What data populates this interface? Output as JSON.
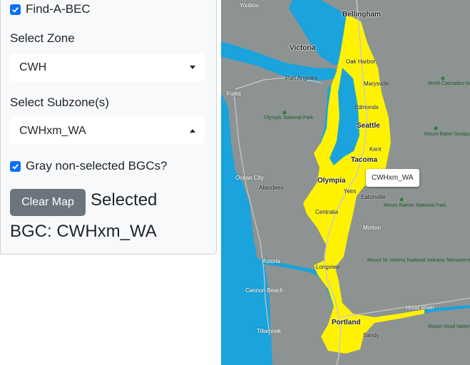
{
  "app": {
    "title": "Find-A-BEC"
  },
  "controls": {
    "zone_label": "Select Zone",
    "zone_value": "CWH",
    "subzone_label": "Select Subzone(s)",
    "subzone_value": "CWHxm_WA",
    "gray_label": "Gray non-selected BGCs?",
    "clear_button": "Clear Map",
    "selected_line1": "Selected",
    "selected_line2": "BGC: CWHxm_WA"
  },
  "map": {
    "tooltip": "CWHxm_WA",
    "colors": {
      "water": "#1aa3dc",
      "land": "#8d9392",
      "highlight": "#fff200"
    },
    "places": {
      "youbou": "Youbou",
      "bellingham": "Bellingham",
      "victoria": "Victoria",
      "oak_harbor": "Oak Harbor",
      "port_angeles": "Port Angeles",
      "marysville": "Marysville",
      "forks": "Forks",
      "edmonds": "Edmonds",
      "seattle": "Seattle",
      "kent": "Kent",
      "tacoma": "Tacoma",
      "ocean_city": "Ocean City",
      "aberdeen": "Aberdeen",
      "olympia": "Olympia",
      "yelm": "Yelm",
      "eatonville": "Eatonville",
      "centralia": "Centralia",
      "morton": "Morton",
      "astoria": "Astoria",
      "longview": "Longview",
      "cannon_beach": "Cannon Beach",
      "tillamook": "Tillamook",
      "portland": "Portland",
      "hood_river": "Hood River",
      "sandy": "Sandy",
      "olympic_np": "Olympic National Park",
      "rainier_np": "Mount Rainier National Park",
      "cascades_np": "North Cascades National Park",
      "st_helens": "Mount St. Helens National Volcanic Monument",
      "mbs_forest": "Mount Baker-Snoqualmie National Forest",
      "hood_forest": "Mount Hood National Forest"
    }
  }
}
